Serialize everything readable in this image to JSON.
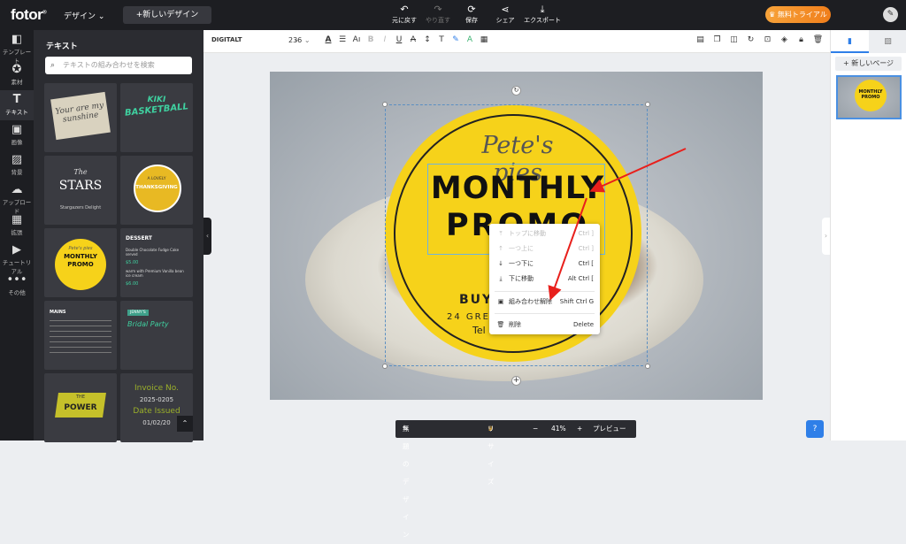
{
  "app": {
    "logo": "fotor",
    "logo_mark": "®",
    "design_menu": "デザイン",
    "new_design": "+新しいデザイン",
    "trial": "無料トライアル",
    "user_icon": "pen-icon"
  },
  "toolbar": {
    "undo": "元に戻す",
    "redo": "やり直す",
    "save": "保存",
    "share": "シェア",
    "export": "エクスポート"
  },
  "left_nav": [
    {
      "label": "テンプレート",
      "icon": "template-icon"
    },
    {
      "label": "素材",
      "icon": "elements-icon"
    },
    {
      "label": "テキスト",
      "icon": "text-icon"
    },
    {
      "label": "画像",
      "icon": "image-icon"
    },
    {
      "label": "背景",
      "icon": "background-icon"
    },
    {
      "label": "アップロード",
      "icon": "upload-icon"
    },
    {
      "label": "拡張",
      "icon": "apps-icon"
    },
    {
      "label": "チュートリアル",
      "icon": "tutorial-icon"
    },
    {
      "label": "その他",
      "icon": "more-icon"
    }
  ],
  "panel": {
    "title": "テキスト",
    "search_placeholder": "テキストの組み合わせを検索",
    "thumbs": {
      "t1": "Your are my sunshine",
      "t2a": "KIKI",
      "t2b": "BASKETBALL",
      "t3a": "The",
      "t3b": "STARS",
      "t3c": "Stargazers Delight",
      "t4a": "A LOVELY",
      "t4b": "THANKSGIVING",
      "t5a": "Pete's pies",
      "t5b": "MONTHLY",
      "t5c": "PROMO",
      "t6a": "DESSERT",
      "t6b": "Double Chocolate Fudge Cake served",
      "t6c": "$5.00",
      "t6d": "warm with Premium Vanilla bean ice cream",
      "t6e": "$6.00",
      "t7a": "MAINS",
      "t8a": "JENNY'S",
      "t8b": "Bridal Party",
      "t9a": "THE",
      "t9b": "POWER",
      "t10a": "Invoice No.",
      "t10b": "2025-0205",
      "t10c": "Date Issued",
      "t10d": "01/02/20"
    }
  },
  "format_bar": {
    "font": "DIGITALT",
    "size": "236"
  },
  "design": {
    "script": "Pete's pies",
    "monthly": "MONTHLY",
    "promo": "PROMO",
    "buy": "BUY",
    "address": "24 GREC",
    "tel": "Tel"
  },
  "context_menu": [
    {
      "label": "トップに移動",
      "shortcut": "Ctrl ]",
      "disabled": true,
      "icon": "bring-to-front-icon"
    },
    {
      "label": "一つ上に",
      "shortcut": "Ctrl ]",
      "disabled": true,
      "icon": "bring-forward-icon"
    },
    {
      "label": "一つ下に",
      "shortcut": "Ctrl [",
      "disabled": false,
      "icon": "send-backward-icon"
    },
    {
      "label": "下に移動",
      "shortcut": "Alt Ctrl [",
      "disabled": false,
      "icon": "send-to-back-icon"
    },
    {
      "label": "組み合わせ解除",
      "shortcut": "Shift Ctrl G",
      "disabled": false,
      "icon": "ungroup-icon"
    },
    {
      "label": "削除",
      "shortcut": "Delete",
      "disabled": false,
      "icon": "trash-icon"
    }
  ],
  "bottom_bar": {
    "design_name": "無題のデザイン",
    "resize": "リサイズ",
    "minus": "−",
    "zoom": "41%",
    "plus": "+",
    "preview": "プレビュー"
  },
  "right_panel": {
    "new_page": "+ 新しいページ",
    "thumb_a": "MONTHLY",
    "thumb_b": "PROMO"
  },
  "colors": {
    "accent": "#2f7fe8",
    "promo_yellow": "#f6d21a",
    "trial_orange": "#f07e1b",
    "arrow_red": "#e8201c"
  }
}
